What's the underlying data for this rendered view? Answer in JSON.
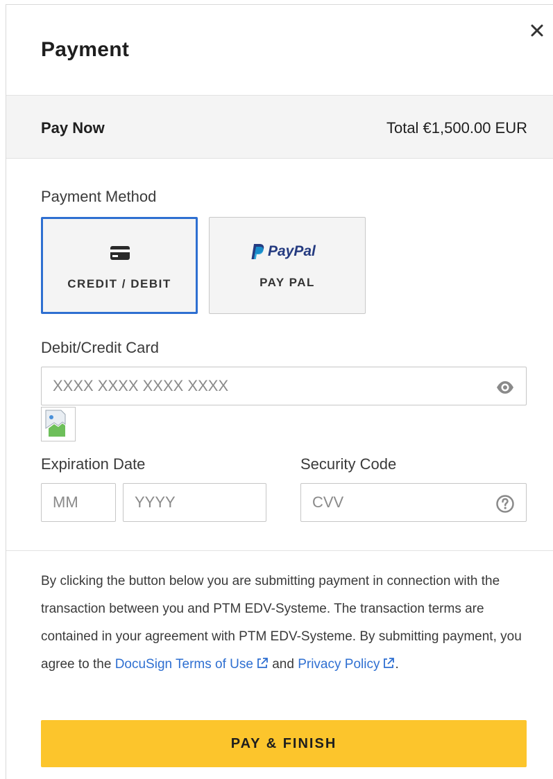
{
  "header": {
    "title": "Payment"
  },
  "summary": {
    "pay_now_label": "Pay Now",
    "total_text": "Total €1,500.00 EUR"
  },
  "payment_method": {
    "label": "Payment Method",
    "options": [
      {
        "label": "CREDIT / DEBIT",
        "icon": "credit-card-icon",
        "selected": true
      },
      {
        "label": "PAY PAL",
        "icon": "paypal-logo",
        "logo_text": "PayPal",
        "selected": false
      }
    ]
  },
  "card": {
    "label": "Debit/Credit Card",
    "placeholder": "XXXX XXXX XXXX XXXX",
    "value": "",
    "toggle_icon": "eye-icon"
  },
  "expiration": {
    "label": "Expiration Date",
    "month_placeholder": "MM",
    "year_placeholder": "YYYY"
  },
  "security": {
    "label": "Security Code",
    "placeholder": "CVV",
    "help_icon": "question-icon"
  },
  "legal": {
    "text_before": "By clicking the button below you are submitting payment in connection with the transaction between you and PTM EDV-Systeme. The transaction terms are contained in your agreement with PTM EDV-Systeme. By submitting payment, you agree to the ",
    "terms_link": "DocuSign Terms of Use",
    "connector": " and ",
    "privacy_link": "Privacy Policy",
    "text_after": "."
  },
  "submit": {
    "label": "PAY & FINISH"
  },
  "colors": {
    "accent_blue": "#2e6fd1",
    "button_yellow": "#fcc52c",
    "band_gray": "#f4f4f4",
    "paypal_dark": "#253b80",
    "paypal_light": "#179bd7"
  }
}
